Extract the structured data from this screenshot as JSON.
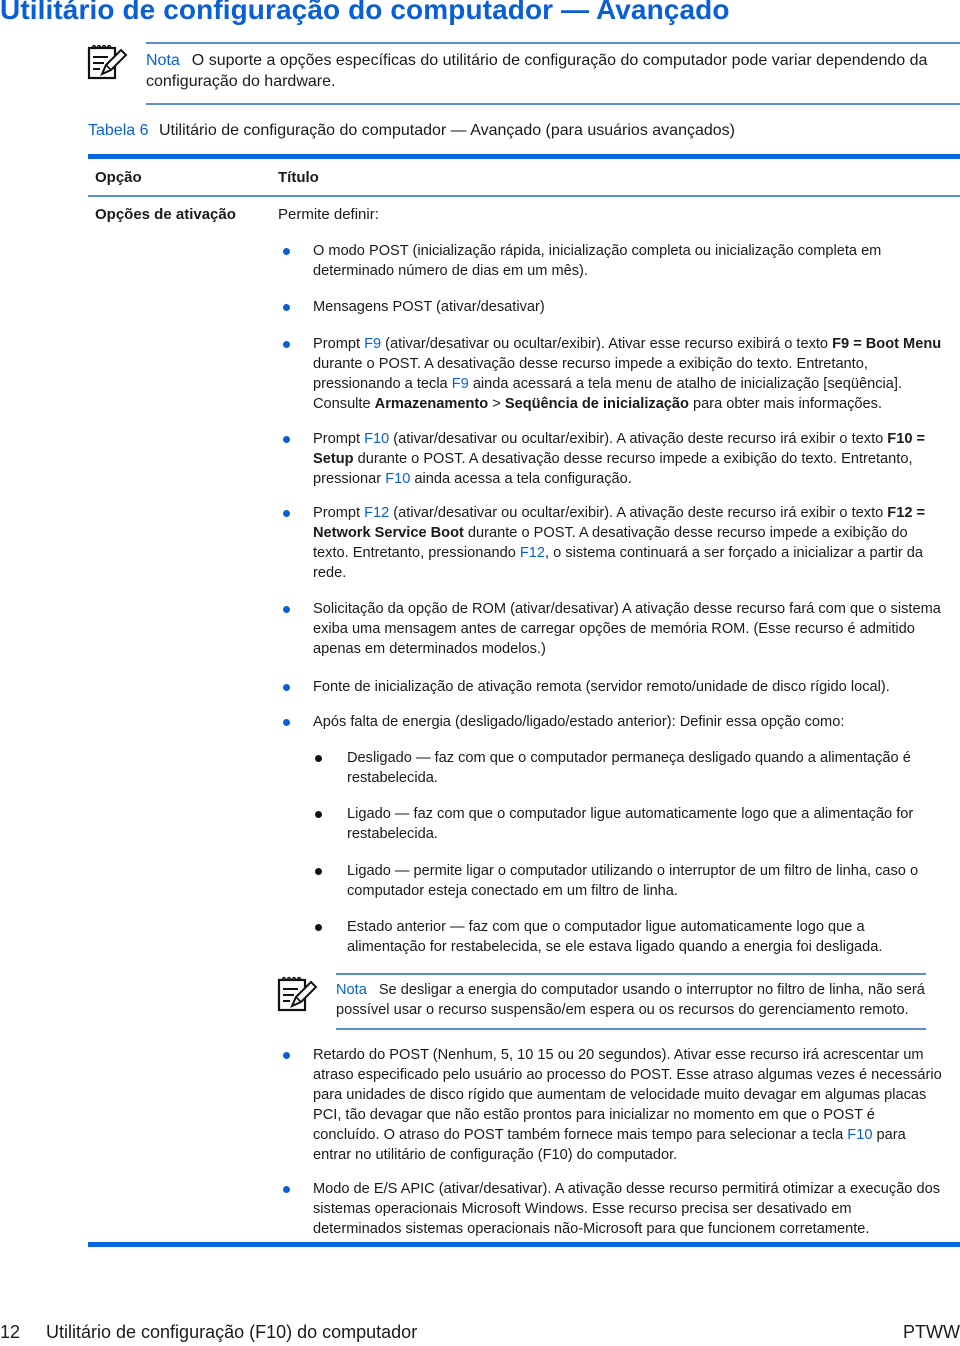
{
  "page_title": "Utilitário de configuração do computador — Avançado",
  "note_top": {
    "label": "Nota",
    "text": "O suporte a opções específicas do utilitário de configuração do computador pode variar dependendo da configuração do hardware."
  },
  "table": {
    "caption_number": "Tabela 6",
    "caption_text": "Utilitário de configuração do computador — Avançado (para usuários avançados)",
    "headers": [
      "Opção",
      "Título"
    ],
    "row_option": "Opções de ativação",
    "row_intro": "Permite definir:",
    "items": [
      {
        "parts": [
          [
            "t",
            "O modo POST (inicialização rápida, inicialização completa ou inicialização completa em determinado número de dias em um mês)."
          ]
        ]
      },
      {
        "parts": [
          [
            "t",
            "Mensagens POST (ativar/desativar)"
          ]
        ]
      },
      {
        "parts": [
          [
            "t",
            "Prompt "
          ],
          [
            "k",
            "F9"
          ],
          [
            "t",
            " (ativar/desativar ou ocultar/exibir). Ativar esse recurso exibirá o texto "
          ],
          [
            "b",
            "F9 = Boot Menu"
          ],
          [
            "t",
            " durante o POST. A desativação desse recurso impede a exibição do texto. Entretanto, pressionando a tecla "
          ],
          [
            "k",
            "F9"
          ],
          [
            "t",
            " ainda acessará a tela menu de atalho de inicialização [seqüência]. Consulte "
          ],
          [
            "b",
            "Armazenamento"
          ],
          [
            "t",
            " > "
          ],
          [
            "b",
            "Seqüência de inicialização"
          ],
          [
            "t",
            " para obter mais informações."
          ]
        ]
      },
      {
        "parts": [
          [
            "t",
            "Prompt "
          ],
          [
            "k",
            "F10"
          ],
          [
            "t",
            " (ativar/desativar ou ocultar/exibir). A ativação deste recurso irá exibir o texto "
          ],
          [
            "b",
            "F10 = Setup"
          ],
          [
            "t",
            " durante o POST. A desativação desse recurso impede a exibição do texto. Entretanto, pressionar "
          ],
          [
            "k",
            "F10"
          ],
          [
            "t",
            " ainda acessa a tela configuração."
          ]
        ]
      },
      {
        "parts": [
          [
            "t",
            "Prompt "
          ],
          [
            "k",
            "F12"
          ],
          [
            "t",
            " (ativar/desativar ou ocultar/exibir). A ativação deste recurso irá exibir o texto "
          ],
          [
            "b",
            "F12 = Network Service Boot"
          ],
          [
            "t",
            " durante o POST. A desativação desse recurso impede a exibição do texto. Entretanto, pressionando "
          ],
          [
            "k",
            "F12"
          ],
          [
            "t",
            ", o sistema continuará a ser forçado a inicializar a partir da rede."
          ]
        ]
      },
      {
        "parts": [
          [
            "t",
            "Solicitação da opção de ROM (ativar/desativar) A ativação desse recurso fará com que o sistema exiba uma mensagem antes de carregar opções de memória ROM. (Esse recurso é admitido apenas em determinados modelos.)"
          ]
        ]
      },
      {
        "parts": [
          [
            "t",
            "Fonte de inicialização de ativação remota (servidor remoto/unidade de disco rígido local)."
          ]
        ]
      },
      {
        "parts": [
          [
            "t",
            "Após falta de energia (desligado/ligado/estado anterior): Definir essa opção como:"
          ]
        ]
      }
    ],
    "sub_items": [
      "Desligado — faz com que o computador permaneça desligado quando a alimentação é restabelecida.",
      "Ligado — faz com que o computador ligue automaticamente logo que a alimentação for restabelecida.",
      "Ligado — permite ligar o computador utilizando o interruptor de um filtro de linha, caso o computador esteja conectado em um filtro de linha.",
      "Estado anterior — faz com que o computador ligue automaticamente logo que a alimentação for restabelecida, se ele estava ligado quando a energia foi desligada."
    ],
    "inner_note": {
      "label": "Nota",
      "text": "Se desligar a energia do computador usando o interruptor no filtro de linha, não será possível usar o recurso suspensão/em espera ou os recursos do gerenciamento remoto."
    },
    "items_after": [
      {
        "parts": [
          [
            "t",
            "Retardo do POST (Nenhum, 5, 10 15 ou 20 segundos). Ativar esse recurso irá acrescentar um atraso especificado pelo usuário ao processo do POST. Esse atraso algumas vezes é necessário para unidades de disco rígido que aumentam de velocidade muito devagar em algumas placas PCI, tão devagar que não estão prontos para inicializar no momento em que o POST é concluído. O atraso do POST também fornece mais tempo para selecionar a tecla "
          ],
          [
            "k",
            "F10"
          ],
          [
            "t",
            " para entrar no utilitário de configuração (F10) do computador."
          ]
        ]
      },
      {
        "parts": [
          [
            "t",
            "Modo de E/S APIC (ativar/desativar). A ativação desse recurso permitirá otimizar a execução dos sistemas operacionais Microsoft Windows. Esse recurso precisa ser desativado em determinados sistemas operacionais não-Microsoft para que funcionem corretamente."
          ]
        ]
      }
    ]
  },
  "footer": {
    "page_number": "12",
    "section": "Utilitário de configuração (F10) do computador",
    "locale": "PTWW"
  },
  "colors": {
    "accent": "#0a5fd6",
    "rule": "#5b8fc9",
    "bar": "#0a66e0"
  }
}
